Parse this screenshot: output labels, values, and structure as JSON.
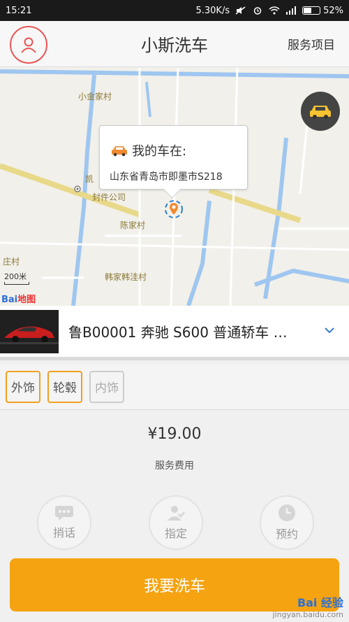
{
  "status_bar": {
    "time": "15:21",
    "network_speed": "5.30K/s",
    "battery_text": "52%",
    "battery_level": 0.52
  },
  "app_bar": {
    "title": "小斯洗车",
    "service_link": "服务项目",
    "profile_icon": "user-icon"
  },
  "map": {
    "labels": [
      "小金家村",
      "凯",
      "封件公司",
      "陈家村",
      "庄村",
      "韩家韩洼村"
    ],
    "bubble_title": "我的车在:",
    "bubble_address": "山东省青岛市即墨市S218",
    "scale": "200米",
    "logo_left": "Bai",
    "logo_right": "地图"
  },
  "vehicle": {
    "description": "鲁B00001 奔驰 S600 普通轿车 …"
  },
  "categories": [
    {
      "label": "外饰",
      "active": true
    },
    {
      "label": "轮毂",
      "active": true
    },
    {
      "label": "内饰",
      "active": false
    }
  ],
  "pricing": {
    "price": "¥19.00",
    "label": "服务费用"
  },
  "actions": {
    "message": "捎话",
    "assign": "指定",
    "reserve": "预约"
  },
  "primary": {
    "label": "我要洗车"
  },
  "watermark": {
    "brand": "Bai 经验",
    "domain": "jingyan.baidu.com"
  },
  "colors": {
    "accent": "#f5a310",
    "profile_ring": "#e85555",
    "chip_active": "#f0a020"
  }
}
